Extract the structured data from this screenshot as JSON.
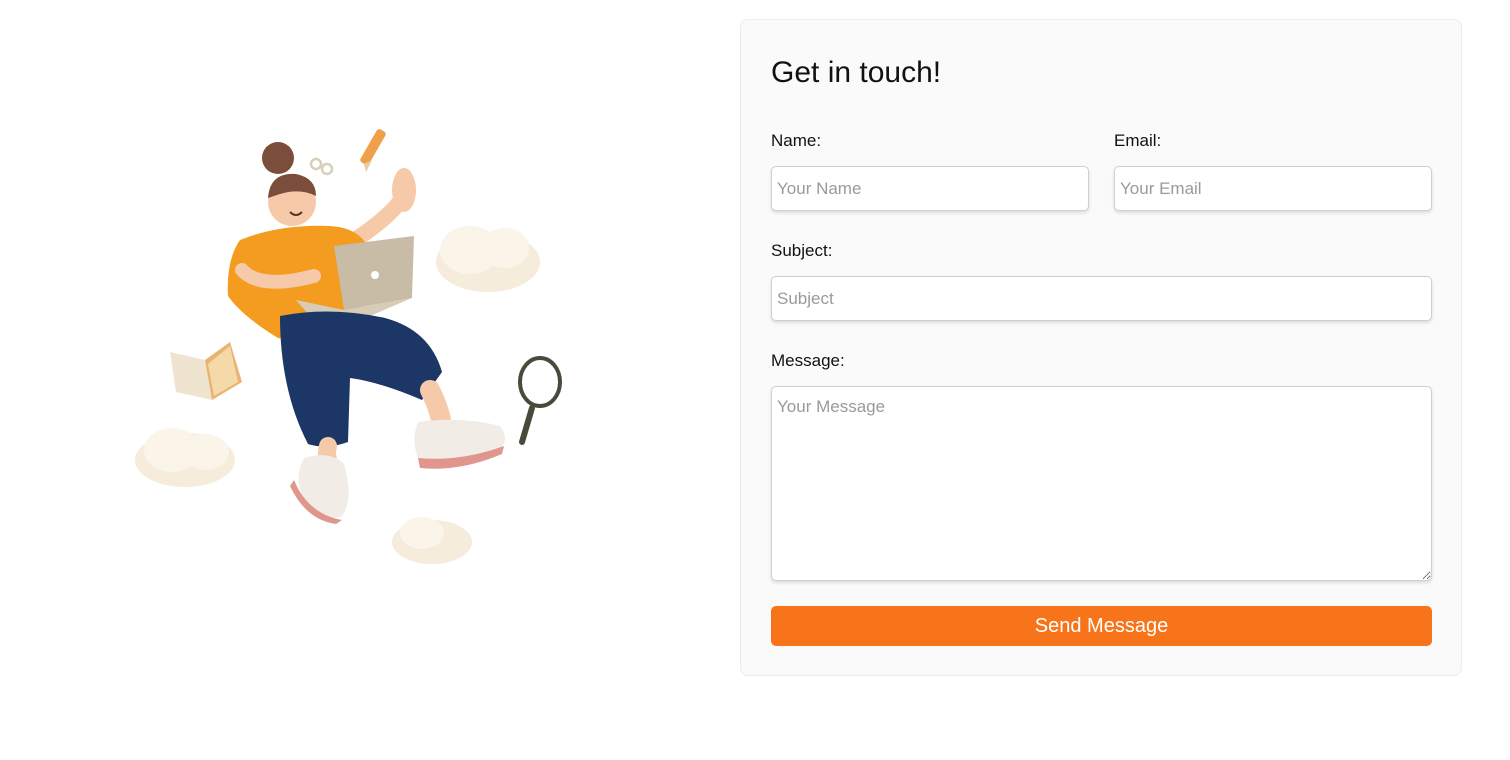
{
  "form": {
    "title": "Get in touch!",
    "name_label": "Name:",
    "name_placeholder": "Your Name",
    "email_label": "Email:",
    "email_placeholder": "Your Email",
    "subject_label": "Subject:",
    "subject_placeholder": "Subject",
    "message_label": "Message:",
    "message_placeholder": "Your Message",
    "submit_label": "Send Message"
  },
  "illustration": {
    "icon": "person-with-laptop-illustration"
  },
  "colors": {
    "accent": "#f7741a",
    "card_background": "#fafafa",
    "placeholder": "#9a9a9a"
  }
}
